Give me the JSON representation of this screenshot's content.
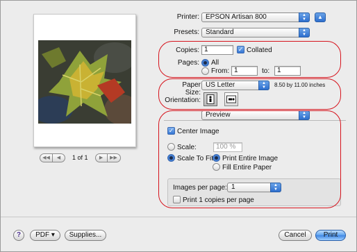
{
  "printer": {
    "label": "Printer:",
    "value": "EPSON Artisan 800"
  },
  "presets": {
    "label": "Presets:",
    "value": "Standard"
  },
  "copies": {
    "label": "Copies:",
    "value": "1",
    "collated_label": "Collated",
    "collated": true
  },
  "pages": {
    "label": "Pages:",
    "all_label": "All",
    "from_label": "From:",
    "from_value": "1",
    "to_label": "to:",
    "to_value": "1",
    "selected": "All"
  },
  "paper_size": {
    "label": "Paper Size:",
    "value": "US Letter",
    "dimensions": "8.50 by 11.00 inches"
  },
  "orientation": {
    "label": "Orientation:",
    "selected": "portrait"
  },
  "section_popup": {
    "value": "Preview"
  },
  "center_image": {
    "label": "Center Image",
    "checked": true
  },
  "scale": {
    "label": "Scale:",
    "value": "100 %"
  },
  "scale_to_fit": {
    "label": "Scale To Fit:",
    "option1": "Print Entire Image",
    "option2": "Fill Entire Paper",
    "selected": "Print Entire Image"
  },
  "images_per_page": {
    "label": "Images per page:",
    "value": "1"
  },
  "print_copies": {
    "label": "Print 1 copies per page",
    "checked": false
  },
  "pager": {
    "label": "1 of 1"
  },
  "footer": {
    "help": "?",
    "pdf": "PDF ▾",
    "supplies": "Supplies...",
    "cancel": "Cancel",
    "print": "Print"
  },
  "colors": {
    "accent": "#3f86e3",
    "annotation": "#d6121b"
  }
}
